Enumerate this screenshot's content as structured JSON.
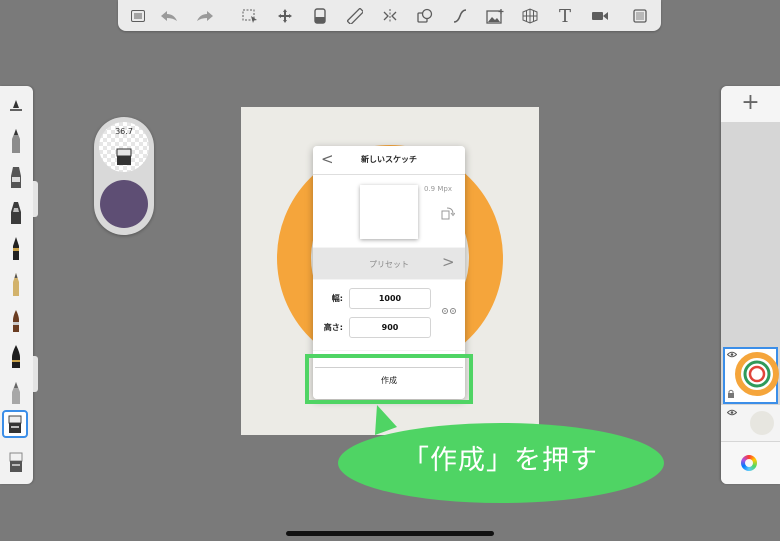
{
  "toolbar": {
    "icons": [
      "list-icon",
      "undo-icon",
      "redo-icon",
      "select-icon",
      "transform-icon",
      "fill-icon",
      "ruler-icon",
      "symmetry-icon",
      "copy-shapes-icon",
      "curve-icon",
      "image-icon",
      "perspective-icon",
      "text-icon",
      "video-icon",
      "fullscreen-icon"
    ],
    "text_tool_label": "T"
  },
  "puck": {
    "size_label": "36.7",
    "color": "#5e4e74"
  },
  "dialog": {
    "back_label": "<",
    "title": "新しいスケッチ",
    "mpx_label": "0.9 Mpx",
    "preset_label": "プリセット",
    "preset_chevron": ">",
    "width_label": "幅:",
    "width_value": "1000",
    "height_label": "高さ:",
    "height_value": "900",
    "create_label": "作成"
  },
  "callout": {
    "text": "「作成」を押す",
    "color": "#4fd464"
  },
  "layers": {
    "add_label": "+"
  },
  "colors": {
    "ring": "#f5a53b",
    "highlight": "#4fd464",
    "selection": "#3b8ee8",
    "canvas": "#ecebe6"
  }
}
